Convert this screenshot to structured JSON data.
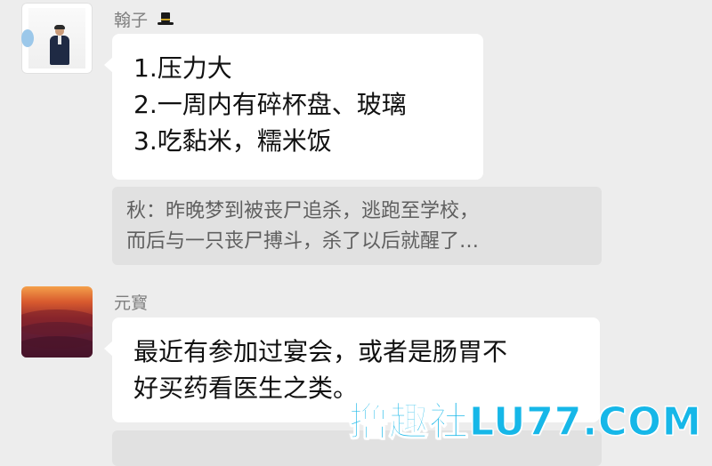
{
  "messages": [
    {
      "sender": "翰子",
      "sender_icon": "top-hat-icon",
      "lines": [
        "1.压力大",
        "2.一周内有碎杯盘、玻璃",
        "3.吃黏米，糯米饭"
      ],
      "quote": {
        "lines": [
          "秋：昨晚梦到被丧尸追杀，逃跑至学校，",
          "而后与一只丧尸搏斗，杀了以后就醒了…"
        ]
      }
    },
    {
      "sender": "元寳",
      "lines": [
        "最近有参加过宴会，或者是肠胃不",
        "好买药看医生之类。"
      ]
    }
  ],
  "watermark": "撸趣社LU77.COM",
  "colors": {
    "background": "#ededed",
    "bubble": "#ffffff",
    "quote": "#e1e1e1",
    "watermark": "#16b7e8"
  }
}
